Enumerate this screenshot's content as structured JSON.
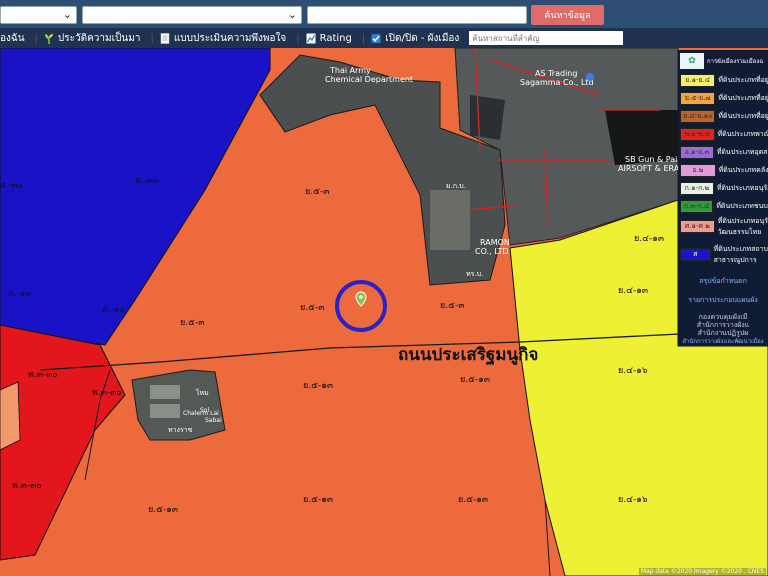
{
  "topbar": {
    "select1_value": "",
    "select2_value": "",
    "input_value": "",
    "search_button": "ค้นหาข้อมูล"
  },
  "nav": {
    "item1": "องฉัน",
    "item2": "ประวัติความเป็นมา",
    "item3": "แบบประเมินความพึงพอใจ",
    "item4": "Rating",
    "item5": "เปิด/ปิด - ผังเมือง",
    "search_placeholder": "ค้นหาสถานที่สำคัญ",
    "layer_checked": true
  },
  "map": {
    "road_name": "ถนนประเสริฐมนูกิจ",
    "places": {
      "army_line1": "Thai Army",
      "army_line2": "Chemical Department",
      "as_trading_line1": "AS Trading",
      "as_trading_line2": "Sagamma Co., Ltd",
      "gun_line1": "SB Gun & Paint",
      "gun_line2": "AIRSOFT & ERAP 11",
      "ramon_line1": "RAMON",
      "ramon_line2": "CO., LTD",
      "small1": "ม.ก.บ.",
      "small2": "ทร.บ.",
      "small3": "ไหม",
      "small4": "ทางราช",
      "small5": "Chalerm Lai",
      "small6": "Sol",
      "small7": "Sabai"
    },
    "zone_labels": {
      "blue1": "ส.-๓๐",
      "blue2": "ส.-๓๐",
      "blue3": "ส.-๑๐",
      "red1": "พ.๓-๓๐",
      "red2": "พ.๓-๓๐",
      "red3": "พ.๓-๓๐",
      "orange1": "ย.๕-๓",
      "orange2": "ย.๕-๓",
      "orange3": "ย.๕-๓",
      "orange4": "ย.๕-๓",
      "orange5": "ย.๕-๑๓",
      "orange6": "ย.๕-๑๓",
      "orange7": "ย.๕-๑๓",
      "orange8": "ย.๕-๑๓",
      "yellow1": "ย.๔-๑๓",
      "yellow2": "ย.๔-๑๖",
      "yellow3": "ย.๔-๑๖"
    },
    "attribution": "Map data ©2020 Imagery ©2020 , CNES",
    "colors": {
      "orange": "#ec6a3c",
      "yellow": "#eef033",
      "blue": "#1a12c6",
      "red": "#e3171b",
      "marker_circle": "#2a21c9"
    }
  },
  "legend": {
    "header": "การผังเมืองรวมเมืองฉ",
    "rows": [
      {
        "code": "ย.๑-ย.๔",
        "color": "#f4f06a",
        "text": "ที่ดินประเภทที่อยู่"
      },
      {
        "code": "ย.๕-ย.๗",
        "color": "#f4a441",
        "text": "ที่ดินประเภทที่อยู่"
      },
      {
        "code": "ย.๘-ย.๑๐",
        "color": "#b7652b",
        "text": "ที่ดินประเภทที่อยู่"
      },
      {
        "code": "พ.๑-พ.๕",
        "color": "#e61f1f",
        "text": "ที่ดินประเภทพาณิ"
      },
      {
        "code": "อ.๑-อ.๓",
        "color": "#9b6bd6",
        "text": "ที่ดินประเภทอุตสา"
      },
      {
        "code": "อ.๒",
        "color": "#e09cd9",
        "text": "ที่ดินประเภทคลัง"
      },
      {
        "code": "ก.๑-ก.๒",
        "color": "#e8f1e2",
        "text": "ที่ดินประเภทอนุรัก"
      },
      {
        "code": "ก.๓-ก.๔",
        "color": "#2b9b3c",
        "text": "ที่ดินประเภทชนบท"
      },
      {
        "code": "ศ.๑-ศ.๒",
        "color": "#f29a8f",
        "text": "ที่ดินประเภทอนุรั"
      },
      {
        "code": "ส",
        "color": "#1b15c8",
        "text": "ที่ดินประเภทสถาบ"
      }
    ],
    "row9_extra": "วัฒนธรรมไทย",
    "row10_extra": "สาธารณูปการ",
    "link1": "สรุปข้อกำหนดก",
    "link2": "รายการประกอบแผนผัง",
    "note1": "กองควบคุมผังเมื",
    "note2": "สำนักการวางผังแ",
    "note3": "สำนักงานปฏิรูปผ",
    "note4": "สำนักการวางผังและพัฒนาเมือง"
  }
}
